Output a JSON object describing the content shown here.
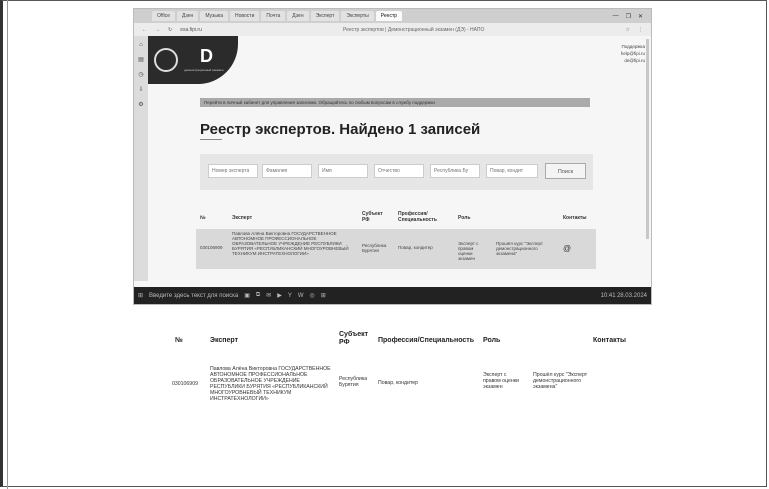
{
  "browser": {
    "tabs": [
      "Office",
      "Дзен",
      "Музыка",
      "Новости",
      "Почта",
      "Дзен",
      "Эксперт",
      "Эксперты",
      "Реестр"
    ],
    "active_tab_index": 8,
    "url": "esa.fipi.ru",
    "page_title": "Реестр экспертов | Демонстрационный экзамен (ДЭ) - НАПО",
    "window_buttons": [
      "—",
      "❐",
      "✕"
    ]
  },
  "site": {
    "logo_letter": "D",
    "logo_subtitle": "демонстрационный экзамен",
    "support_lines": [
      "Поддержка",
      "help@fipi.ru",
      "de@fipi.ru"
    ],
    "banner": "Перейти в личный кабинет для управления записями. Обращайтесь по любым вопросам в службу поддержки",
    "title": "Реестр экспертов. Найдено 1 записей"
  },
  "filters": {
    "fields": [
      "Номер эксперта",
      "Фамилия",
      "Имя",
      "Отчество",
      "Республика Бу",
      "Повар, кондит"
    ],
    "search_button": "Поиск"
  },
  "table_top": {
    "headers": {
      "num": "№",
      "expert": "Эксперт",
      "region": "Субъект РФ",
      "profession": "Профессия/ Специальность",
      "role": "Роль",
      "contacts": "Контакты"
    },
    "row": {
      "num": "030106909",
      "expert": "Павлова Алёна Викторовна ГОСУДАРСТВЕННОЕ АВТОНОМНОЕ ПРОФЕССИОНАЛЬНОЕ ОБРАЗОВАТЕЛЬНОЕ УЧРЕЖДЕНИЕ РЕСПУБЛИКИ БУРЯТИЯ «РЕСПУБЛИКАНСКИЙ МНОГОУРОВНЕВЫЙ ТЕХНИКУМ ИНСТРАТЕХНОЛОГИИ»",
      "region": "Республика Бурятия",
      "profession": "Повар, кондитер",
      "role": "Эксперт с правом оценки экзамен",
      "training": "Прошёл курс \"Эксперт демонстрационного экзамена\"",
      "contact_icon": "email-icon"
    }
  },
  "taskbar": {
    "start": "⊞",
    "search_label": "Введите здесь текст для поиска",
    "apps": [
      "▣",
      "⧉",
      "✉",
      "▶",
      "Y",
      "W",
      "◎",
      "⊞"
    ],
    "clock_time": "10:41",
    "clock_date": "28.03.2024"
  },
  "table_bottom": {
    "headers": {
      "num": "№",
      "expert": "Эксперт",
      "region": "Субъект РФ",
      "profession": "Профессия/Специальность",
      "role": "Роль",
      "contacts": "Контакты"
    },
    "row": {
      "num": "030106909",
      "expert": "Павлова Алёна Викторовна ГОСУДАРСТВЕННОЕ АВТОНОМНОЕ ПРОФЕССИОНАЛЬНОЕ ОБРАЗОВАТЕЛЬНОЕ УЧРЕЖДЕНИЕ РЕСПУБЛИКИ БУРЯТИЯ «РЕСПУБЛИКАНСКИЙ МНОГОУРОВНЕВЫЙ ТЕХНИКУМ ИНСТРАТЕХНОЛОГИИ»",
      "region": "Республика Бурятия",
      "profession": "Повар, кондитер",
      "role": "Эксперт с правом оценки экзамен",
      "training": "Прошёл курс \"Эксперт демонстрационного экзамена\""
    }
  }
}
